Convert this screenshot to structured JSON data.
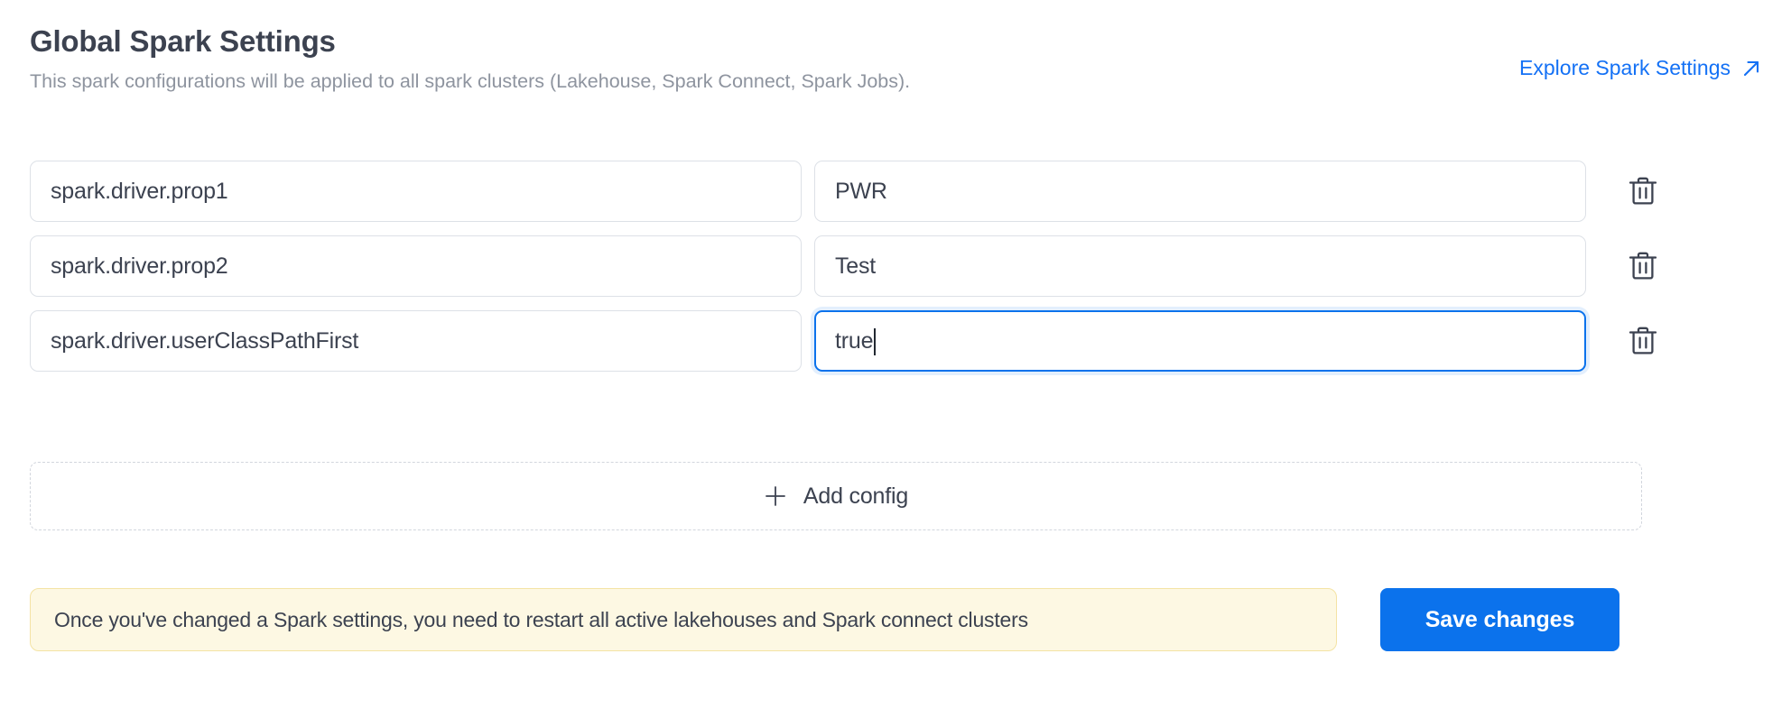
{
  "header": {
    "title": "Global Spark Settings",
    "subtitle": "This spark configurations will be applied to all spark clusters (Lakehouse, Spark Connect, Spark Jobs).",
    "explore_link_label": "Explore Spark Settings",
    "explore_link_icon": "external-link-arrow-icon",
    "link_color": "#1471f5"
  },
  "configs": {
    "rows": [
      {
        "key": "spark.driver.prop1",
        "value": "PWR",
        "key_placeholder": "",
        "value_placeholder": "",
        "focused": false,
        "delete_icon": "trash-icon"
      },
      {
        "key": "spark.driver.prop2",
        "value": "Test",
        "key_placeholder": "",
        "value_placeholder": "",
        "focused": false,
        "delete_icon": "trash-icon"
      },
      {
        "key": "spark.driver.userClassPathFirst",
        "value": "true",
        "key_placeholder": "",
        "value_placeholder": "",
        "focused": true,
        "delete_icon": "trash-icon"
      }
    ],
    "add_config_label": "Add config",
    "add_config_icon": "plus-icon"
  },
  "footer": {
    "warning_text": "Once you've changed a Spark settings, you need to restart all active lakehouses and Spark connect clusters",
    "warning_bg": "#fdf8e3",
    "warning_border": "#f4e3a4",
    "save_label": "Save changes",
    "save_bg": "#0b72ec"
  }
}
